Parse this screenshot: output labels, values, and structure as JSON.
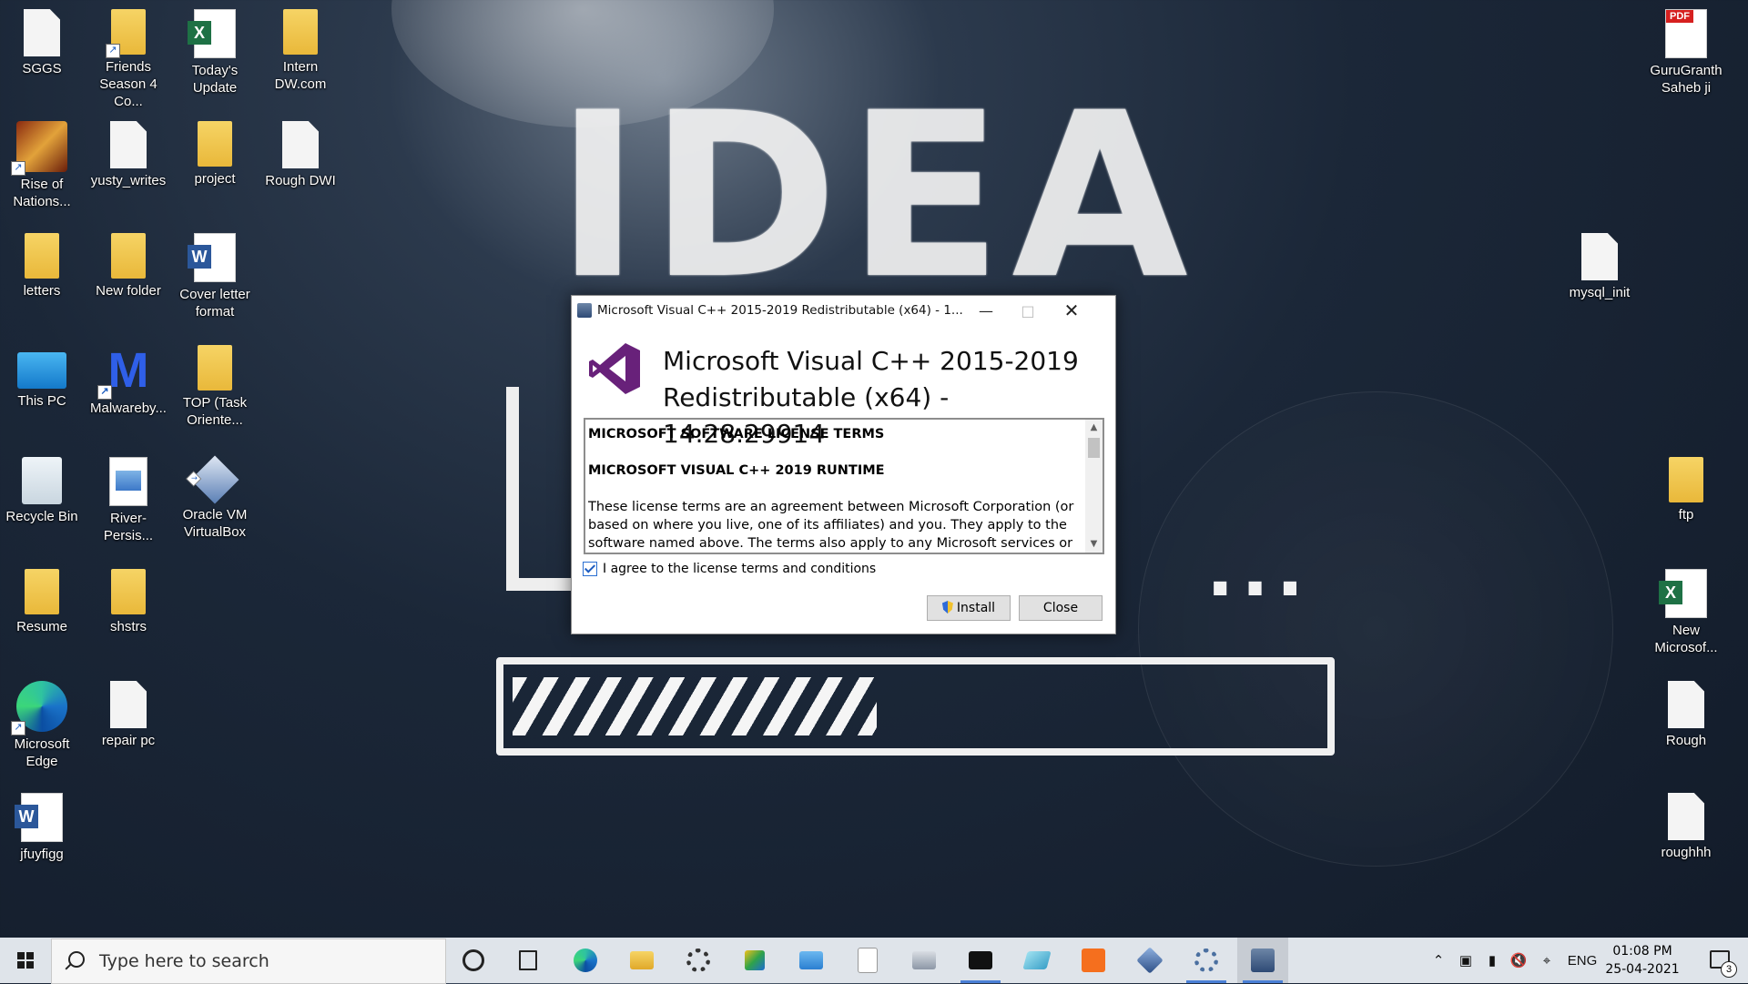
{
  "desktop": {
    "icons_left": [
      {
        "label": "SGGS",
        "type": "file"
      },
      {
        "label": "Friends Season 4 Co...",
        "type": "folder",
        "shortcut": true
      },
      {
        "label": "Today's Update",
        "type": "excel"
      },
      {
        "label": "Intern DW.com",
        "type": "folder"
      },
      {
        "label": "Rise of Nations...",
        "type": "game",
        "shortcut": true
      },
      {
        "label": "yusty_writes",
        "type": "file"
      },
      {
        "label": "project",
        "type": "folder"
      },
      {
        "label": "Rough DWI",
        "type": "file"
      },
      {
        "label": "letters",
        "type": "folder"
      },
      {
        "label": "New folder",
        "type": "folder"
      },
      {
        "label": "Cover letter format",
        "type": "word"
      },
      {
        "label": "This PC",
        "type": "pc"
      },
      {
        "label": "Malwareby...",
        "type": "malware",
        "shortcut": true
      },
      {
        "label": "TOP (Task Oriente...",
        "type": "folder"
      },
      {
        "label": "Recycle Bin",
        "type": "recycle"
      },
      {
        "label": "River-Persis...",
        "type": "image"
      },
      {
        "label": "Oracle VM VirtualBox",
        "type": "vbox",
        "shortcut": true
      },
      {
        "label": "Resume",
        "type": "folder"
      },
      {
        "label": "shstrs",
        "type": "folder"
      },
      {
        "label": "Microsoft Edge",
        "type": "edge",
        "shortcut": true
      },
      {
        "label": "repair pc",
        "type": "file"
      },
      {
        "label": "jfuyfigg",
        "type": "word"
      }
    ],
    "icons_right": [
      {
        "label": "GuruGranth Saheb ji",
        "type": "pdf"
      },
      {
        "label": "mysql_init",
        "type": "file"
      },
      {
        "label": "ftp",
        "type": "folder"
      },
      {
        "label": "New Microsof...",
        "type": "excel"
      },
      {
        "label": "Rough",
        "type": "file"
      },
      {
        "label": "roughhh",
        "type": "file"
      }
    ]
  },
  "dialog": {
    "title": "Microsoft Visual C++ 2015-2019 Redistributable (x64) - 1...",
    "product_line1": "Microsoft Visual C++ 2015-2019",
    "product_line2": "Redistributable (x64) - 14.28.29914",
    "license_heading1": "MICROSOFT SOFTWARE LICENSE TERMS",
    "license_heading2": "MICROSOFT VISUAL C++ 2019 RUNTIME",
    "license_body": "These license terms are an agreement between Microsoft Corporation (or based on where you live, one of its affiliates) and you. They apply to the software named above. The terms also apply to any Microsoft services or",
    "agree_label": "I agree to the license terms and conditions",
    "agree_checked": true,
    "install_label": "Install",
    "close_label": "Close"
  },
  "taskbar": {
    "search_placeholder": "Type here to search",
    "apps": [
      "cortana-circle",
      "task-view",
      "edge",
      "file-explorer",
      "settings",
      "snipping-tool",
      "control-panel",
      "python-file",
      "photos",
      "terminal",
      "virtualbox-manager",
      "xampp",
      "3d-box",
      "system-settings",
      "installer"
    ],
    "language": "ENG",
    "time": "01:08 PM",
    "date": "25-04-2021",
    "notification_count": "3"
  },
  "colors": {
    "vs_purple": "#68217a",
    "taskbar_bg": "#dfe4ea",
    "accent_blue": "#4a7fd6"
  }
}
